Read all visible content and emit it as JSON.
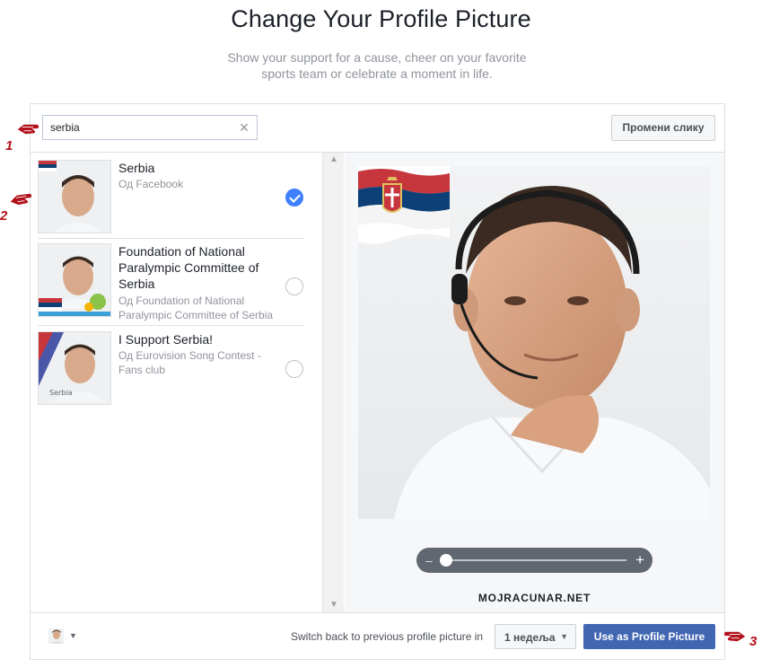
{
  "header": {
    "title": "Change Your Profile Picture",
    "subtitle": "Show your support for a cause, cheer on your favorite sports team or celebrate a moment in life."
  },
  "search": {
    "value": "serbia"
  },
  "toolbar": {
    "change_picture_label": "Промени слику"
  },
  "frames": [
    {
      "title": "Serbia",
      "source": "Од Facebook",
      "selected": true
    },
    {
      "title": "Foundation of National Paralympic Committee of Serbia",
      "source": "Од Foundation of National Paralympic Committee of Serbia",
      "selected": false
    },
    {
      "title": "I Support Serbia!",
      "source": "Од Eurovision Song Contest - Fans club",
      "selected": false
    }
  ],
  "preview": {
    "watermark": "MOJRACUNAR.NET",
    "zoom_level": 0.0
  },
  "footer": {
    "switch_label": "Switch back to previous profile picture in",
    "duration_value": "1 недеља",
    "submit_label": "Use as Profile Picture"
  },
  "annotations": [
    "1",
    "2",
    "3"
  ],
  "colors": {
    "accent": "#4267b2",
    "check": "#4080ff",
    "marker": "#b3121c"
  }
}
